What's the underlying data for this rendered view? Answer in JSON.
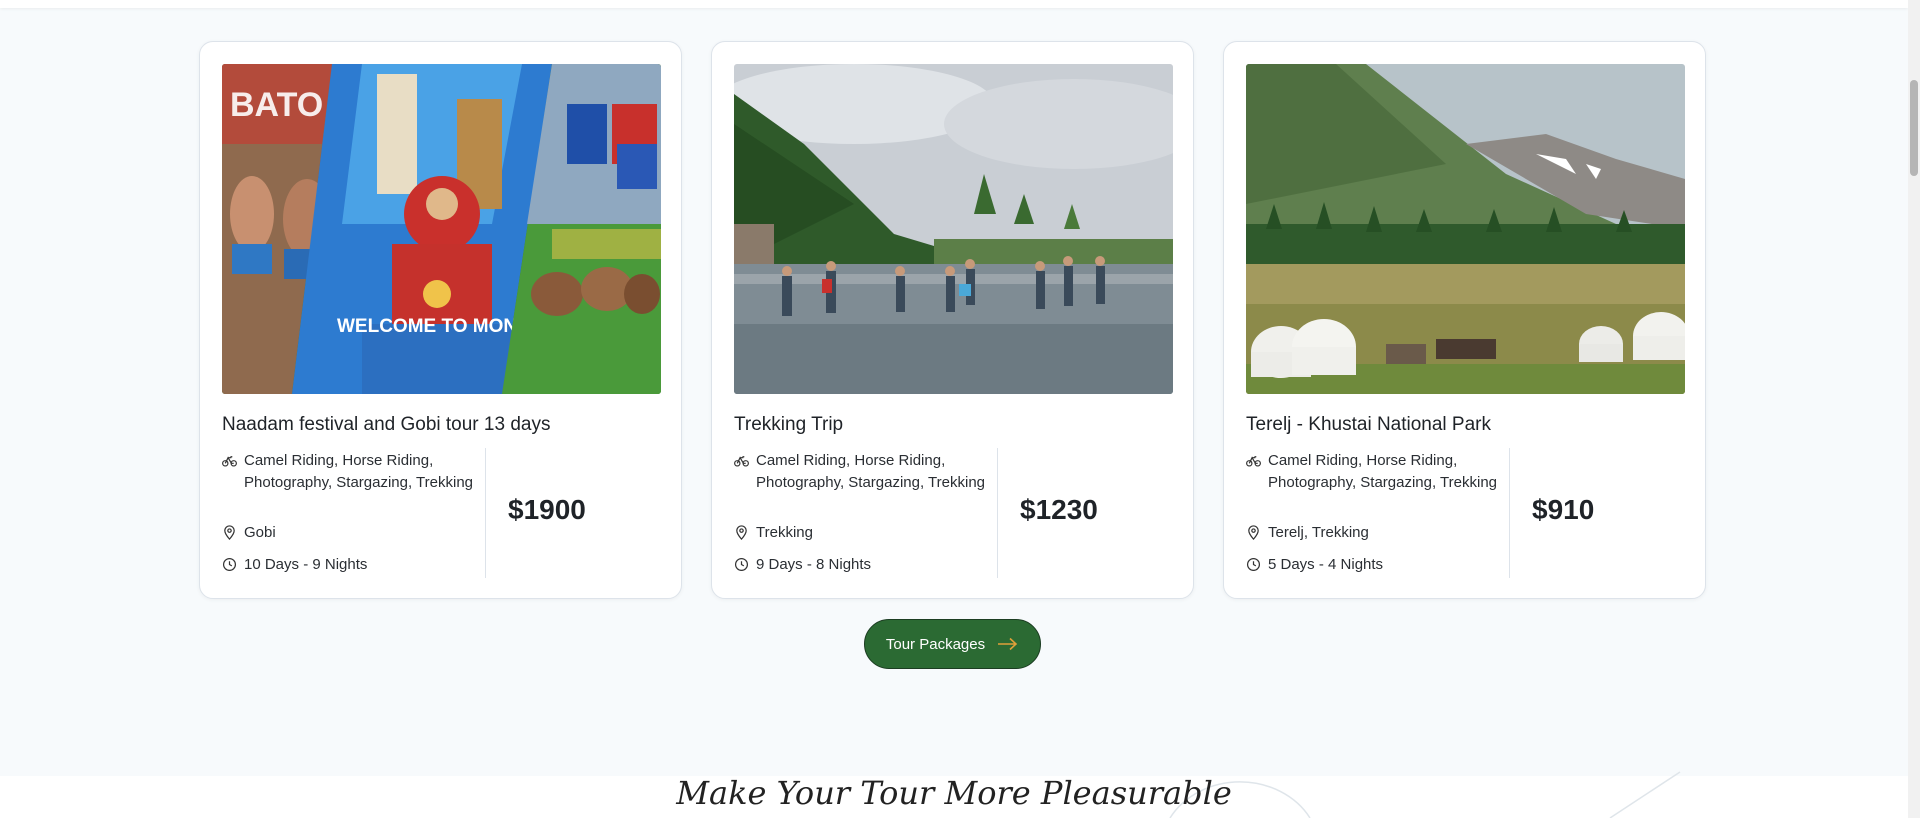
{
  "cards": [
    {
      "title": "Naadam festival and Gobi tour 13 days",
      "activities": "Camel Riding, Horse Riding, Photography, Stargazing, Trekking",
      "location": "Gobi",
      "duration": "10 Days - 9 Nights",
      "price": "$1900",
      "photo_overlay": "WELCOME TO MONGOLIA"
    },
    {
      "title": "Trekking Trip",
      "activities": "Camel Riding, Horse Riding, Photography, Stargazing, Trekking",
      "location": "Trekking",
      "duration": "9 Days - 8 Nights",
      "price": "$1230"
    },
    {
      "title": "Terelj - Khustai National Park",
      "activities": "Camel Riding, Horse Riding, Photography, Stargazing, Trekking",
      "location": "Terelj, Trekking",
      "duration": "5 Days - 4 Nights",
      "price": "$910"
    }
  ],
  "cta": {
    "label": "Tour Packages",
    "icon": "arrow-right-icon"
  },
  "section": {
    "title": "Make Your Tour More Pleasurable"
  },
  "icons": {
    "activities": "bicycle-icon",
    "location": "map-pin-icon",
    "duration": "clock-icon"
  },
  "colors": {
    "page_bg": "#f7fafc",
    "card_bg": "#ffffff",
    "card_border": "#dde3ea",
    "cta_bg": "#2b6a33",
    "cta_arrow": "#e0a03a",
    "text": "#1f2328"
  }
}
